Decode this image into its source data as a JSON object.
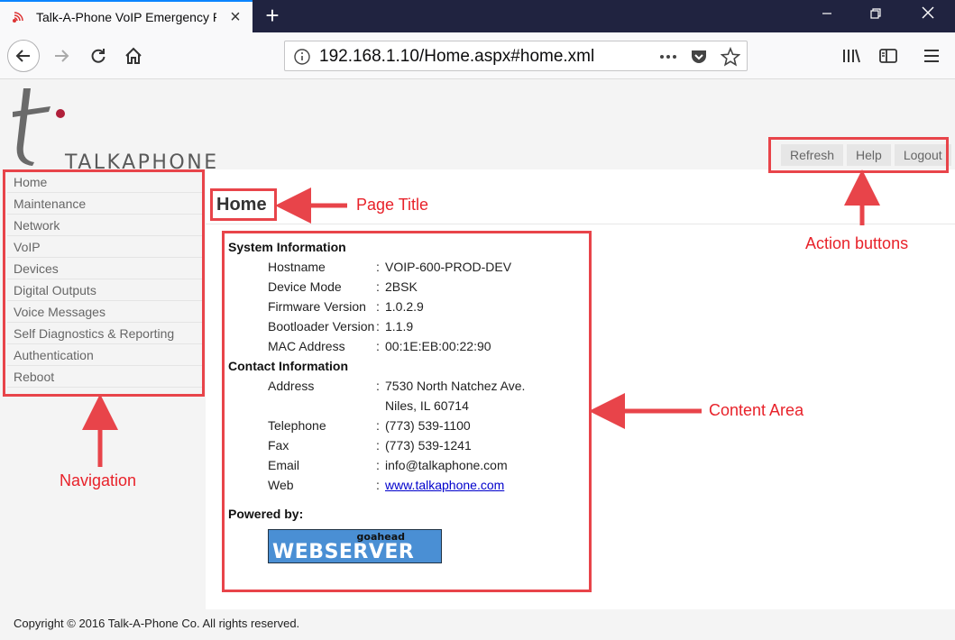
{
  "browser": {
    "tab_title": "Talk-A-Phone VoIP Emergency P",
    "url": "192.168.1.10/Home.aspx#home.xml"
  },
  "header": {
    "brand": "TALKAPHONE",
    "actions": [
      "Refresh",
      "Help",
      "Logout"
    ]
  },
  "sidebar": {
    "items": [
      "Home",
      "Maintenance",
      "Network",
      "VoIP",
      "Devices",
      "Digital Outputs",
      "Voice Messages",
      "Self Diagnostics & Reporting",
      "Authentication",
      "Reboot"
    ]
  },
  "main": {
    "title": "Home",
    "system_info": {
      "heading": "System Information",
      "rows": [
        {
          "label": "Hostname",
          "value": "VOIP-600-PROD-DEV"
        },
        {
          "label": "Device Mode",
          "value": "2BSK"
        },
        {
          "label": "Firmware Version",
          "value": "1.0.2.9"
        },
        {
          "label": "Bootloader Version",
          "value": "1.1.9"
        },
        {
          "label": "MAC Address",
          "value": "00:1E:EB:00:22:90"
        }
      ]
    },
    "contact_info": {
      "heading": "Contact Information",
      "address_label": "Address",
      "address_line1": "7530 North Natchez Ave.",
      "address_line2": "Niles, IL 60714",
      "telephone_label": "Telephone",
      "telephone": "(773) 539-1100",
      "fax_label": "Fax",
      "fax": "(773) 539-1241",
      "email_label": "Email",
      "email": "info@talkaphone.com",
      "web_label": "Web",
      "web": "www.talkaphone.com"
    },
    "powered_by": "Powered by:",
    "goahead_top": "goahead",
    "goahead_main": "WEBSERVER"
  },
  "footer": {
    "copyright": "Copyright © 2016 Talk-A-Phone Co. All rights reserved."
  },
  "annotations": {
    "page_title": "Page Title",
    "action_buttons": "Action buttons",
    "content_area": "Content Area",
    "navigation": "Navigation",
    "color": "#e8444a"
  }
}
